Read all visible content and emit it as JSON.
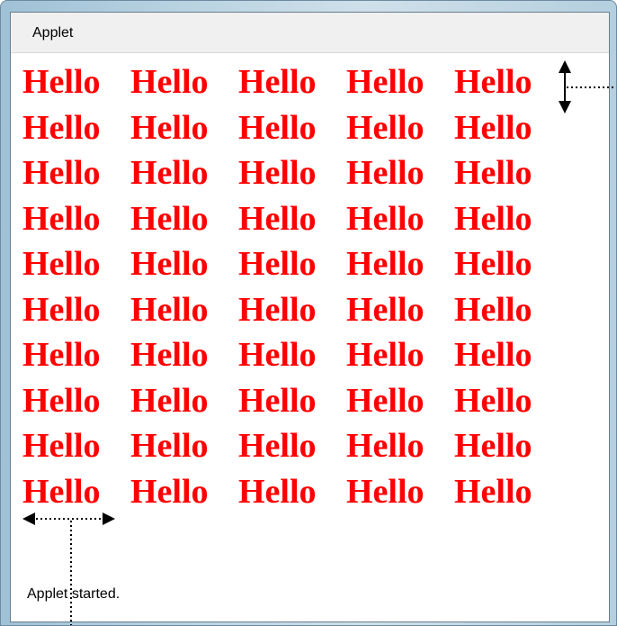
{
  "window": {
    "title": "Applet"
  },
  "content": {
    "word": "Hello",
    "rows": 10,
    "columns": 5,
    "text_color": "#ff0000"
  },
  "status": {
    "text": "Applet started."
  }
}
